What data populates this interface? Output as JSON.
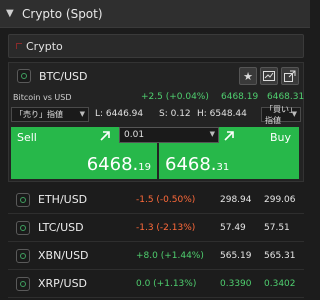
{
  "header": {
    "title": "Crypto (Spot)",
    "caret": "▼"
  },
  "subheader": {
    "label": "Crypto"
  },
  "main": {
    "symbol": "BTC/USD",
    "description": "Bitcoin vs USD",
    "change": "+2.5 (+0.04%)",
    "bid_head": "6468.19",
    "ask_head": "6468.31",
    "sell_type": "「売り」指値",
    "low": "L: 6446.94",
    "spread": "S: 0.12",
    "high": "H: 6548.44",
    "buy_type": "「買い」指値",
    "quantity": "0.01",
    "sell_label": "Sell",
    "buy_label": "Buy",
    "sell_price_main": "6468.",
    "sell_price_frac": "19",
    "buy_price_main": "6468.",
    "buy_price_frac": "31",
    "tools": [
      "star-icon",
      "chart-icon",
      "popout-icon"
    ]
  },
  "watchlist": [
    {
      "symbol": "ETH/USD",
      "change": "-1.5 (-0.50%)",
      "direction": "neg",
      "bid": "298.94",
      "ask": "299.06"
    },
    {
      "symbol": "LTC/USD",
      "change": "-1.3 (-2.13%)",
      "direction": "neg",
      "bid": "57.49",
      "ask": "57.51"
    },
    {
      "symbol": "XBN/USD",
      "change": "+8.0 (+1.44%)",
      "direction": "pos",
      "bid": "565.19",
      "ask": "565.31"
    },
    {
      "symbol": "XRP/USD",
      "change": "0.0 (+1.13%)",
      "direction": "pos",
      "bid": "0.3390",
      "ask": "0.3402"
    }
  ],
  "colors": {
    "buy_sell_green": "#27b84a",
    "negative": "#ff6a3a",
    "positive": "#4fcf6f"
  }
}
